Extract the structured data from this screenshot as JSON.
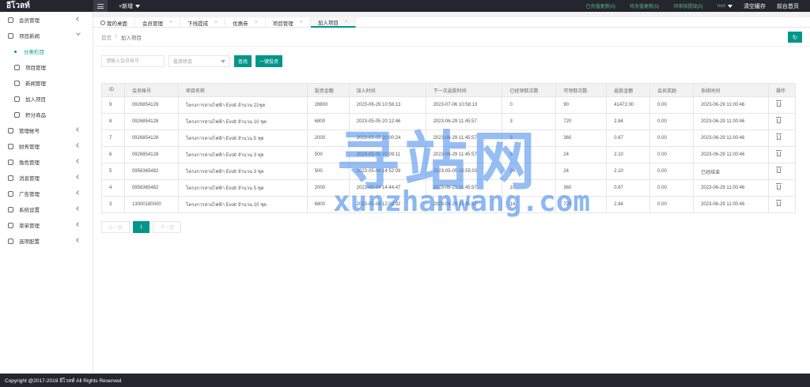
{
  "topbar": {
    "brand": "อีโวลท์",
    "new_label": "+新增",
    "links": [
      "已充值更新(0)",
      "待充值更新(0)",
      "待审核提现(0)"
    ],
    "user": "root",
    "clear_cache": "清空缓存",
    "backend_home": "前台首页"
  },
  "sidebar": {
    "items": [
      {
        "label": "会员管理",
        "icon": "user-icon",
        "sub": false,
        "arrow": "left"
      },
      {
        "label": "项目新闻",
        "icon": "grid-icon",
        "sub": false,
        "arrow": "down"
      },
      {
        "label": "分类栏目",
        "icon": "bullet-icon",
        "sub": true,
        "active": true
      },
      {
        "label": "项目管理",
        "icon": "list-icon",
        "sub": true
      },
      {
        "label": "新闻管理",
        "icon": "doc-icon",
        "sub": true
      },
      {
        "label": "加入项目",
        "icon": "cart-icon",
        "sub": true
      },
      {
        "label": "积分商品",
        "icon": "image-icon",
        "sub": true
      },
      {
        "label": "管理帐号",
        "icon": "user-group-icon",
        "sub": false,
        "arrow": "left"
      },
      {
        "label": "财务管理",
        "icon": "finance-icon",
        "sub": false,
        "arrow": "left"
      },
      {
        "label": "角色管理",
        "icon": "shield-icon",
        "sub": false,
        "arrow": "left"
      },
      {
        "label": "消息管理",
        "icon": "message-icon",
        "sub": false,
        "arrow": "left"
      },
      {
        "label": "广告管理",
        "icon": "ad-icon",
        "sub": false,
        "arrow": "left"
      },
      {
        "label": "系统设置",
        "icon": "gear-icon",
        "sub": false,
        "arrow": "left"
      },
      {
        "label": "菜单管理",
        "icon": "menu-icon",
        "sub": false,
        "arrow": "left"
      },
      {
        "label": "选项配置",
        "icon": "config-icon",
        "sub": false,
        "arrow": "left"
      }
    ]
  },
  "tabs": [
    {
      "label": "我的桌面",
      "home": true
    },
    {
      "label": "会员管理"
    },
    {
      "label": "下线提成"
    },
    {
      "label": "优惠券"
    },
    {
      "label": "项目管理"
    },
    {
      "label": "加入项目",
      "active": true
    }
  ],
  "breadcrumb": {
    "home": "首页",
    "sep": "/",
    "current": "加入项目"
  },
  "filters": {
    "account_placeholder": "请输入会员帐号",
    "status_placeholder": "投资状态",
    "search_label": "查找",
    "one_click_label": "一键投资"
  },
  "table": {
    "headers": [
      "ID",
      "会员帐号",
      "项目名称",
      "投资金额",
      "加入时间",
      "下一次返款时间",
      "已经领取次数",
      "可领取次数",
      "返款金额",
      "会员奖励",
      "系统时间",
      "操作"
    ],
    "rows": [
      [
        "9",
        "0926854128",
        "โครงการสายไฟฟ้า Evolt จำนวน 21ชุด",
        "28800",
        "2023-06-29 10:58:13",
        "2023-07-06 10:58:13",
        "0",
        "90",
        "41472.00",
        "0.00",
        "2023-06-29 11:00:46"
      ],
      [
        "8",
        "0926854128",
        "โครงการสายไฟฟ้า Evolt จำนวน 10 ชุด",
        "6800",
        "2023-05-05 20:12:46",
        "2023-06-29 11:45:57",
        "3",
        "720",
        "2.84",
        "0.00",
        "2023-06-29 11:00:46"
      ],
      [
        "7",
        "0926854128",
        "โครงการสายไฟฟ้า Evolt จำนวน 5 ชุด",
        "2000",
        "2023-05-05 20:00:24",
        "2023-06-29 11:45:57",
        "3",
        "360",
        "0.67",
        "0.00",
        "2023-06-29 11:00:46"
      ],
      [
        "6",
        "0926854128",
        "โครงการสายไฟฟ้า Evolt จำนวน 3 ชุด",
        "500",
        "2023-05-05 20:09:11",
        "2023-06-29 11:45:57",
        "3",
        "24",
        "2.10",
        "0.00",
        "2023-06-29 11:00:46"
      ],
      [
        "5",
        "0956365482",
        "โครงการสายไฟฟ้า Evolt จำนวน 3 ชุด",
        "500",
        "2023-05-04 14:52:09",
        "2023-05-05 15:55:02",
        "24",
        "24",
        "2.10",
        "0.00",
        "已经结束"
      ],
      [
        "4",
        "0956365482",
        "โครงการสายไฟฟ้า Evolt จำนวน 5 ชุด",
        "2000",
        "2023-05-04 14:44:47",
        "2023-06-29 11:45:57",
        "10",
        "360",
        "0.67",
        "0.00",
        "2023-06-29 11:00:46"
      ],
      [
        "3",
        "13000180000",
        "โครงการสายไฟฟ้า Evolt จำนวน 10 ชุด",
        "6800",
        "2023-05-04 12:02:32",
        "2023-06-29 11:45:57",
        "14",
        "720",
        "2.84",
        "0.00",
        "2023-06-29 11:00:46"
      ]
    ]
  },
  "pager": {
    "prev": "上一页",
    "current": "1",
    "next": "下一页"
  },
  "footer": {
    "copyright": "Copyright @2017-2019 อีโวลท์ All Rights Reserved"
  },
  "watermark": {
    "cn": "寻站网",
    "en": "xunzhanwang.com"
  }
}
